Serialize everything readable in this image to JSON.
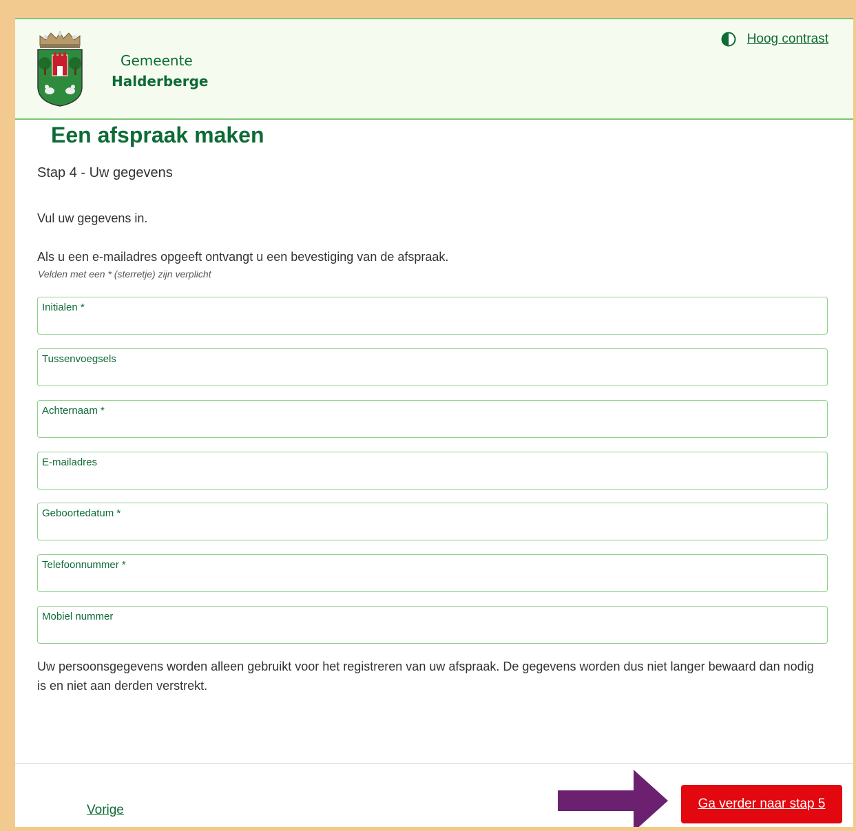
{
  "header": {
    "brand_line1": "Gemeente",
    "brand_line2": "Halderberge",
    "contrast_link": "Hoog contrast"
  },
  "page": {
    "title": "Een afspraak maken",
    "step": "Stap 4 - Uw gegevens",
    "intro": "Vul uw gegevens in.",
    "email_note": "Als u een e-mailadres opgeeft ontvangt u een bevestiging van de afspraak.",
    "required_note": "Velden met een * (sterretje) zijn verplicht"
  },
  "form": {
    "fields": [
      {
        "label": "Initialen *",
        "value": ""
      },
      {
        "label": "Tussenvoegsels",
        "value": ""
      },
      {
        "label": "Achternaam *",
        "value": ""
      },
      {
        "label": "E-mailadres",
        "value": ""
      },
      {
        "label": "Geboortedatum *",
        "value": ""
      },
      {
        "label": "Telefoonnummer *",
        "value": ""
      },
      {
        "label": "Mobiel nummer",
        "value": ""
      }
    ]
  },
  "privacy_text": "Uw persoonsgegevens worden alleen gebruikt voor het registreren van uw afspraak. De gegevens worden dus niet langer bewaard dan nodig is en niet aan derden verstrekt.",
  "footer": {
    "prev_label": "Vorige",
    "next_label": "Ga verder naar stap 5"
  },
  "colors": {
    "brand_green": "#0d6b35",
    "field_border": "#8fd08a",
    "next_button": "#e3070f",
    "annotation_arrow": "#6b2170",
    "frame": "#f2c98f"
  },
  "icons": {
    "contrast": "contrast-icon",
    "logo": "coat-of-arms-logo",
    "annotation": "arrow-right-icon"
  }
}
